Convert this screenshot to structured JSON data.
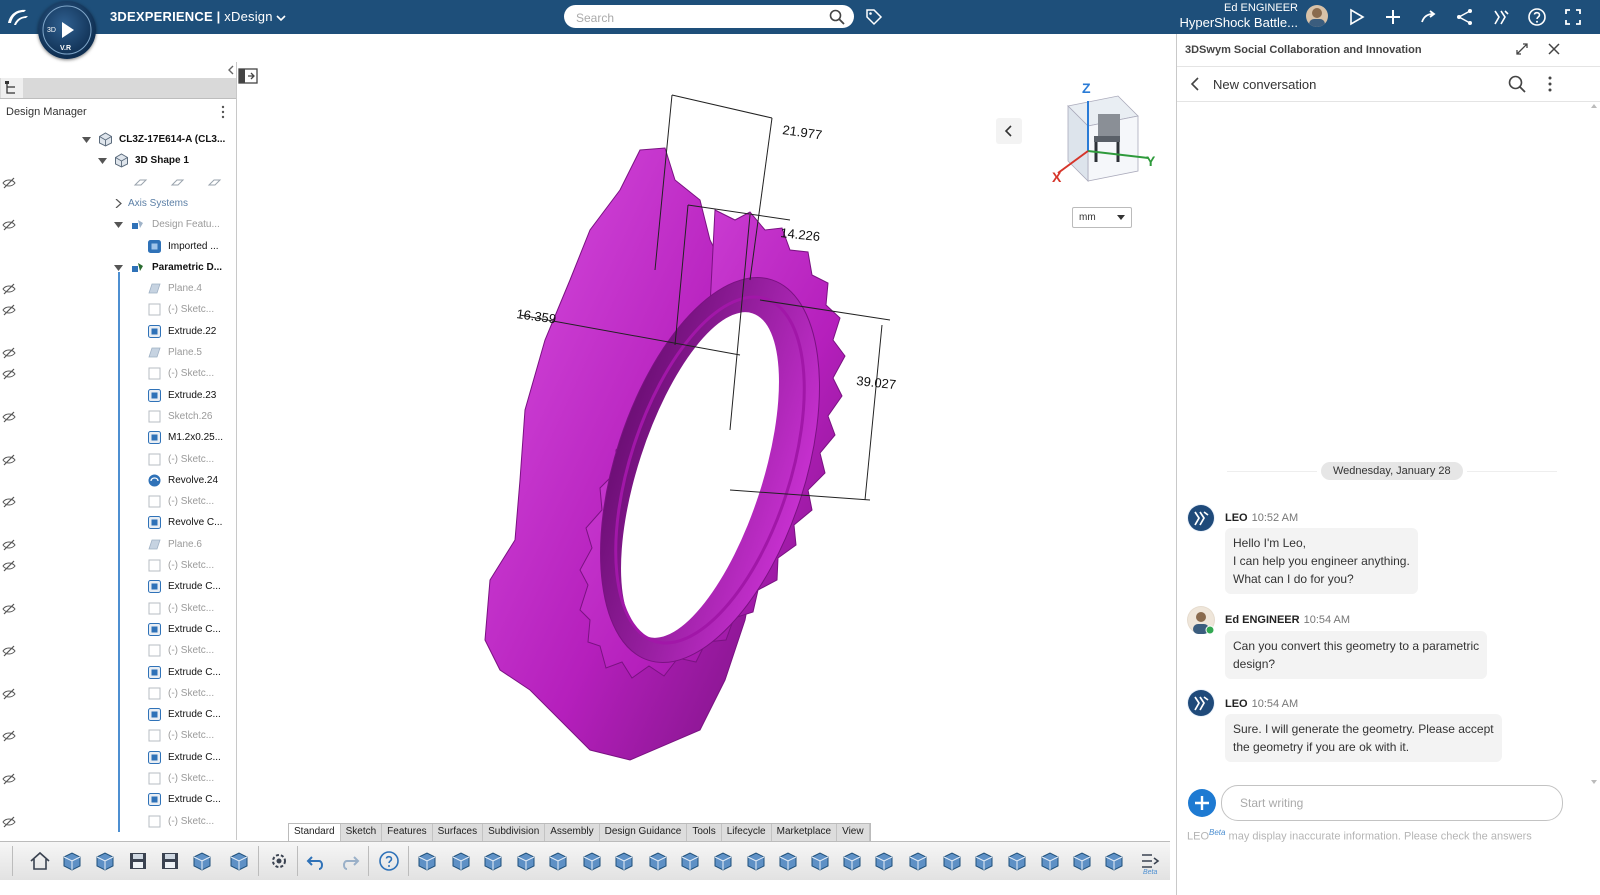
{
  "topbar": {
    "brand": "3DEXPERIENCE",
    "separator": "|",
    "app": "xDesign",
    "compass_label": "V.R",
    "compass_3d": "3D",
    "search_placeholder": "Search",
    "user_role": "Ed ENGINEER",
    "user_context": "HyperShock Battle..."
  },
  "left_panel": {
    "header": "Design Manager",
    "tree": [
      {
        "label": "CL3Z-17E614-A (CL3...",
        "style": "bold",
        "icon": "product-icon",
        "eye": false
      },
      {
        "label": "3D Shape 1",
        "style": "bold",
        "icon": "shape-icon",
        "eye": false
      },
      {
        "label": "",
        "style": "planes",
        "icon": "plane-icons",
        "eye": true
      },
      {
        "label": "Axis Systems",
        "style": "blue",
        "icon": "",
        "eye": false
      },
      {
        "label": "Design Featu...",
        "style": "dim",
        "icon": "features-icon",
        "eye": true
      },
      {
        "label": "Imported ...",
        "style": "normal",
        "icon": "imported-icon",
        "eye": false
      },
      {
        "label": "Parametric D...",
        "style": "bold",
        "icon": "parametric-icon",
        "eye": false
      },
      {
        "label": "Plane.4",
        "style": "dim",
        "icon": "plane-icon",
        "eye": true
      },
      {
        "label": "(-)  Sketc...",
        "style": "dim",
        "icon": "sketch-icon",
        "eye": true
      },
      {
        "label": "Extrude.22",
        "style": "normal",
        "icon": "extrude-icon",
        "eye": false
      },
      {
        "label": "Plane.5",
        "style": "dim",
        "icon": "plane-icon",
        "eye": true
      },
      {
        "label": "(-)  Sketc...",
        "style": "dim",
        "icon": "sketch-icon",
        "eye": true
      },
      {
        "label": "Extrude.23",
        "style": "normal",
        "icon": "extrude-icon",
        "eye": false
      },
      {
        "label": "Sketch.26",
        "style": "dim",
        "icon": "sketch-icon",
        "eye": true
      },
      {
        "label": "M1.2x0.25...",
        "style": "normal",
        "icon": "hole-icon",
        "eye": false
      },
      {
        "label": "(-)  Sketc...",
        "style": "dim",
        "icon": "sketch-icon",
        "eye": true
      },
      {
        "label": "Revolve.24",
        "style": "normal",
        "icon": "revolve-icon",
        "eye": false
      },
      {
        "label": "(-)  Sketc...",
        "style": "dim",
        "icon": "sketch-icon",
        "eye": true
      },
      {
        "label": "Revolve C...",
        "style": "normal",
        "icon": "revolve-cut-icon",
        "eye": false
      },
      {
        "label": "Plane.6",
        "style": "dim",
        "icon": "plane-icon",
        "eye": true
      },
      {
        "label": "(-)  Sketc...",
        "style": "dim",
        "icon": "sketch-icon",
        "eye": true
      },
      {
        "label": "Extrude C...",
        "style": "normal",
        "icon": "extrude-cut-icon",
        "eye": false
      },
      {
        "label": "(-)  Sketc...",
        "style": "dim",
        "icon": "sketch-icon",
        "eye": true
      },
      {
        "label": "Extrude C...",
        "style": "normal",
        "icon": "extrude-cut-icon",
        "eye": false
      },
      {
        "label": "(-)  Sketc...",
        "style": "dim",
        "icon": "sketch-icon",
        "eye": true
      },
      {
        "label": "Extrude C...",
        "style": "normal",
        "icon": "extrude-cut-icon",
        "eye": false
      },
      {
        "label": "(-)  Sketc...",
        "style": "dim",
        "icon": "sketch-icon",
        "eye": true
      },
      {
        "label": "Extrude C...",
        "style": "normal",
        "icon": "extrude-cut-icon",
        "eye": false
      },
      {
        "label": "(-)  Sketc...",
        "style": "dim",
        "icon": "sketch-icon",
        "eye": true
      },
      {
        "label": "Extrude C...",
        "style": "normal",
        "icon": "extrude-cut-icon",
        "eye": false
      },
      {
        "label": "(-)  Sketc...",
        "style": "dim",
        "icon": "sketch-icon",
        "eye": true
      },
      {
        "label": "Extrude C...",
        "style": "normal",
        "icon": "extrude-cut-icon",
        "eye": false
      },
      {
        "label": "(-)  Sketc...",
        "style": "dim",
        "icon": "sketch-icon",
        "eye": true
      }
    ]
  },
  "viewport": {
    "dimensions": [
      "21.977",
      "14.226",
      "16.359",
      "39.027"
    ],
    "unit": "mm",
    "axes": {
      "x": "X",
      "y": "Y",
      "z": "Z"
    },
    "model_color": "#c22cc8"
  },
  "toolbar": {
    "tabs": [
      "Standard",
      "Sketch",
      "Features",
      "Surfaces",
      "Subdivision",
      "Assembly",
      "Design Guidance",
      "Tools",
      "Lifecycle",
      "Marketplace",
      "View"
    ],
    "active_tab": "Standard",
    "beta_label": "Beta"
  },
  "chat": {
    "title": "3DSwym Social Collaboration and Innovation",
    "subtitle": "New conversation",
    "date": "Wednesday, January 28",
    "messages": [
      {
        "author": "LEO",
        "time": "10:52 AM",
        "lines": [
          "Hello I'm Leo,",
          "I can help you engineer anything.",
          "What can I do for you?"
        ]
      },
      {
        "author": "Ed ENGINEER",
        "time": "10:54 AM",
        "lines": [
          "Can you convert this geometry to a parametric",
          "design?"
        ]
      },
      {
        "author": "LEO",
        "time": "10:54 AM",
        "lines": [
          "Sure. I will generate the geometry. Please accept",
          "the geometry if you are ok with it."
        ]
      }
    ],
    "input_placeholder": "Start writing",
    "disclaimer_brand": "LEO",
    "disclaimer_beta": "Beta",
    "disclaimer_text": "may display inaccurate information. Please check the answers"
  },
  "colors": {
    "topbar": "#1e4f7a",
    "accent": "#1e7ad2",
    "model": "#c22cc8"
  }
}
